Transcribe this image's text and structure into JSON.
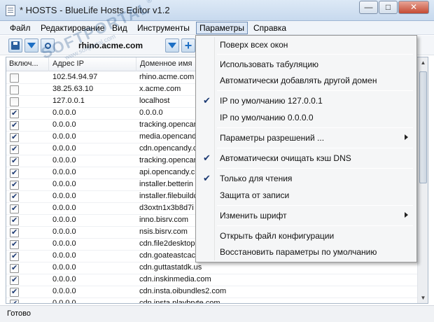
{
  "window": {
    "title": "* HOSTS - BlueLife Hosts Editor v1.2",
    "minimize_glyph": "—",
    "maximize_glyph": "□",
    "close_glyph": "✕",
    "icon": "document-icon"
  },
  "menubar": {
    "items": [
      "Файл",
      "Редактирование",
      "Вид",
      "Инструменты",
      "Параметры",
      "Справка"
    ],
    "active": "Параметры"
  },
  "toolbar": {
    "current_host": "rhino.acme.com",
    "buttons": [
      "save-icon",
      "download-icon",
      "search-icon",
      "download-icon",
      "plus-icon"
    ]
  },
  "table": {
    "columns": [
      "Включ...",
      "Адрес IP",
      "Доменное имя"
    ],
    "rows": [
      {
        "checked": false,
        "ip": "102.54.94.97",
        "domain": "rhino.acme.com"
      },
      {
        "checked": false,
        "ip": "38.25.63.10",
        "domain": "x.acme.com"
      },
      {
        "checked": false,
        "ip": "127.0.0.1",
        "domain": "localhost"
      },
      {
        "checked": true,
        "ip": "0.0.0.0",
        "domain": "0.0.0.0"
      },
      {
        "checked": true,
        "ip": "0.0.0.0",
        "domain": "tracking.opencan"
      },
      {
        "checked": true,
        "ip": "0.0.0.0",
        "domain": "media.opencand"
      },
      {
        "checked": true,
        "ip": "0.0.0.0",
        "domain": "cdn.opencandy.c"
      },
      {
        "checked": true,
        "ip": "0.0.0.0",
        "domain": "tracking.opencan"
      },
      {
        "checked": true,
        "ip": "0.0.0.0",
        "domain": "api.opencandy.c"
      },
      {
        "checked": true,
        "ip": "0.0.0.0",
        "domain": "installer.betterin"
      },
      {
        "checked": true,
        "ip": "0.0.0.0",
        "domain": "installer.filebuildc"
      },
      {
        "checked": true,
        "ip": "0.0.0.0",
        "domain": "d3oxtn1x3b8d7i"
      },
      {
        "checked": true,
        "ip": "0.0.0.0",
        "domain": "inno.bisrv.com"
      },
      {
        "checked": true,
        "ip": "0.0.0.0",
        "domain": "nsis.bisrv.com"
      },
      {
        "checked": true,
        "ip": "0.0.0.0",
        "domain": "cdn.file2desktop"
      },
      {
        "checked": true,
        "ip": "0.0.0.0",
        "domain": "cdn.goateastcac"
      },
      {
        "checked": true,
        "ip": "0.0.0.0",
        "domain": "cdn.guttastatdk.us"
      },
      {
        "checked": true,
        "ip": "0.0.0.0",
        "domain": "cdn.inskinmedia.com"
      },
      {
        "checked": true,
        "ip": "0.0.0.0",
        "domain": "cdn.insta.oibundles2.com"
      },
      {
        "checked": true,
        "ip": "0.0.0.0",
        "domain": "cdn.insta.playbryte.com"
      }
    ]
  },
  "dropdown": {
    "items": [
      {
        "label": "Поверх всех окон",
        "checked": false,
        "submenu": false
      },
      {
        "label": "Использовать табуляцию",
        "checked": false,
        "submenu": false
      },
      {
        "label": "Автоматически добавлять другой домен",
        "checked": false,
        "submenu": false
      },
      {
        "label": "IP по умолчанию  127.0.0.1",
        "checked": true,
        "submenu": false
      },
      {
        "label": "IP по умолчанию  0.0.0.0",
        "checked": false,
        "submenu": false
      },
      {
        "label": "Параметры разрешений ...",
        "checked": false,
        "submenu": true
      },
      {
        "label": "Автоматически очищать кэш DNS",
        "checked": true,
        "submenu": false
      },
      {
        "label": "Только для чтения",
        "checked": true,
        "submenu": false
      },
      {
        "label": "Защита от записи",
        "checked": false,
        "submenu": false
      },
      {
        "label": "Изменить шрифт",
        "checked": false,
        "submenu": true
      },
      {
        "label": "Открыть файл конфигурации",
        "checked": false,
        "submenu": false
      },
      {
        "label": "Восстановить параметры по умолчанию",
        "checked": false,
        "submenu": false
      }
    ],
    "check_glyph": "✔"
  },
  "statusbar": {
    "text": "Готово"
  },
  "watermark": {
    "big": "SOFTPORTAL",
    "small": "www.softportal.com",
    "mark": "®"
  }
}
